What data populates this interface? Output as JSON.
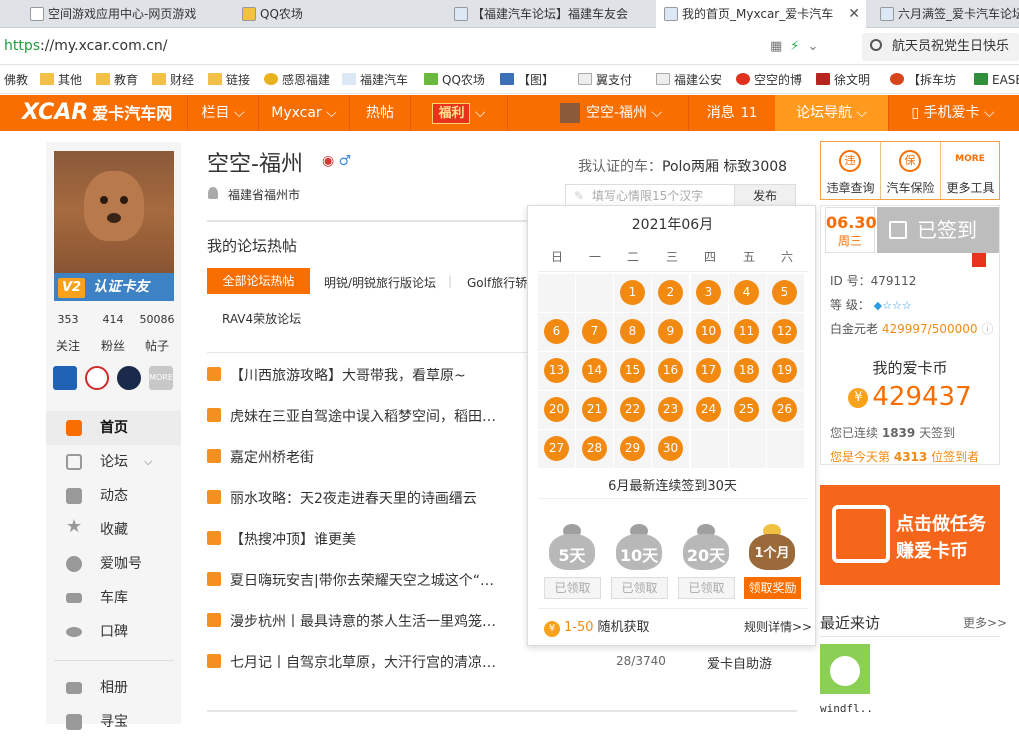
{
  "browser": {
    "tabs": [
      {
        "label": "空间游戏应用中心-网页游戏",
        "active": false
      },
      {
        "label": "QQ农场",
        "active": false
      },
      {
        "label": "【福建汽车论坛】福建车友会",
        "active": false
      },
      {
        "label": "我的首页_Myxcar_爱卡汽车",
        "active": true
      },
      {
        "label": "六月满签_爱卡汽车论坛",
        "active": false
      }
    ],
    "url_scheme": "https",
    "url_rest": "://my.xcar.com.cn/",
    "search_text": "航天员祝党生日快乐",
    "bookmarks": [
      "佛教",
      "其他",
      "教育",
      "财经",
      "链接",
      "感恩福建",
      "福建汽车",
      "QQ农场",
      "【图】",
      "翼支付",
      "福建公安",
      "空空的博",
      "徐文明",
      "【拆车坊",
      "EASE"
    ]
  },
  "nav": {
    "logo": "XCAR",
    "logo_cn": "爱卡汽车网",
    "items": [
      "栏目",
      "Myxcar",
      "热帖",
      "福利",
      "空空-福州",
      "消息",
      "论坛导航",
      "手机爱卡"
    ],
    "msg_count": "11"
  },
  "sidebar": {
    "badge_v": "V2",
    "badge_text": "认证卡友",
    "stats": [
      {
        "value": "353",
        "label": "关注"
      },
      {
        "value": "414",
        "label": "粉丝"
      },
      {
        "value": "50086",
        "label": "帖子"
      }
    ],
    "menu": [
      {
        "label": "首页",
        "active": true
      },
      {
        "label": "论坛",
        "active": false
      },
      {
        "label": "动态",
        "active": false
      },
      {
        "label": "收藏",
        "active": false
      },
      {
        "label": "爱咖号",
        "active": false
      },
      {
        "label": "车库",
        "active": false
      },
      {
        "label": "口碑",
        "active": false
      },
      {
        "label": "相册",
        "active": false
      },
      {
        "label": "寻宝",
        "active": false
      }
    ],
    "medal_more": "MORE"
  },
  "profile": {
    "name": "空空-福州",
    "location": "福建省福州市",
    "cars_label": "我认证的车：",
    "cars": "Polo两厢  标致3008",
    "mood_placeholder": "填写心情限15个汉字",
    "publish": "发布"
  },
  "hot": {
    "title": "我的论坛热帖",
    "tab_all": "全部论坛热帖",
    "tabs": [
      "明锐/明锐旅行版论坛",
      "Golf旅行轿",
      "RAV4荣放论坛"
    ],
    "posts": [
      {
        "title": "【川西旅游攻略】大哥带我，看草原~",
        "stat": "",
        "forum": ""
      },
      {
        "title": "虎妹在三亚自驾途中误入稻梦空间，稻田…",
        "stat": "",
        "forum": ""
      },
      {
        "title": "嘉定州桥老街",
        "stat": "",
        "forum": ""
      },
      {
        "title": "丽水攻略：天2夜走进春天里的诗画缙云",
        "stat": "",
        "forum": ""
      },
      {
        "title": "【热搜冲顶】谁更美",
        "stat": "",
        "forum": ""
      },
      {
        "title": "夏日嗨玩安吉|带你去荣耀天空之城这个“…",
        "stat": "",
        "forum": ""
      },
      {
        "title": "漫步杭州丨最具诗意的茶人生活一里鸡笼…",
        "stat": "",
        "forum": ""
      },
      {
        "title": "七月记丨自驾京北草原，大汗行宫的清凉…",
        "stat": "28/3740",
        "forum": "爱卡自助游"
      }
    ]
  },
  "calendar": {
    "title": "2021年06月",
    "weekdays": [
      "日",
      "一",
      "二",
      "三",
      "四",
      "五",
      "六"
    ],
    "days": [
      "1",
      "2",
      "3",
      "4",
      "5",
      "6",
      "7",
      "8",
      "9",
      "10",
      "11",
      "12",
      "13",
      "14",
      "15",
      "16",
      "17",
      "18",
      "19",
      "20",
      "21",
      "22",
      "23",
      "24",
      "25",
      "26",
      "27",
      "28",
      "29",
      "30"
    ],
    "streak": "6月最新连续签到30天",
    "rewards": [
      {
        "label": "5天",
        "claim": "已领取",
        "claimed": true
      },
      {
        "label": "10天",
        "claim": "已领取",
        "claimed": true
      },
      {
        "label": "20天",
        "claim": "已领取",
        "claimed": true
      },
      {
        "label": "1个月",
        "claim": "领取奖励",
        "claimed": false
      }
    ],
    "range": "1-50",
    "range_text": "随机获取",
    "rules": "规则详情>>"
  },
  "right": {
    "tools": [
      "违章查询",
      "汽车保险",
      "更多工具"
    ],
    "tool_icons": [
      "违",
      "保",
      "MORE"
    ],
    "date": "06.30",
    "weekday": "周三",
    "signed": "已签到",
    "id_label": "ID 号：",
    "id": "479112",
    "level_label": "等    级：",
    "level_stars": "◆☆☆☆",
    "plat_label": "白金元老",
    "plat_value": "429997/500000",
    "coin_title": "我的爱卡币",
    "coin_value": "429437",
    "streak_pre": "您已连续",
    "streak_days": "1839",
    "streak_post": "天签到",
    "rank_pre": "您是今天第",
    "rank_num": "4313",
    "rank_post": "位签到者",
    "task1": "点击做任务",
    "task2": "赚爱卡币",
    "visitors_title": "最近来访",
    "visitors_more": "更多>>",
    "visitor_name": "windfl.."
  }
}
